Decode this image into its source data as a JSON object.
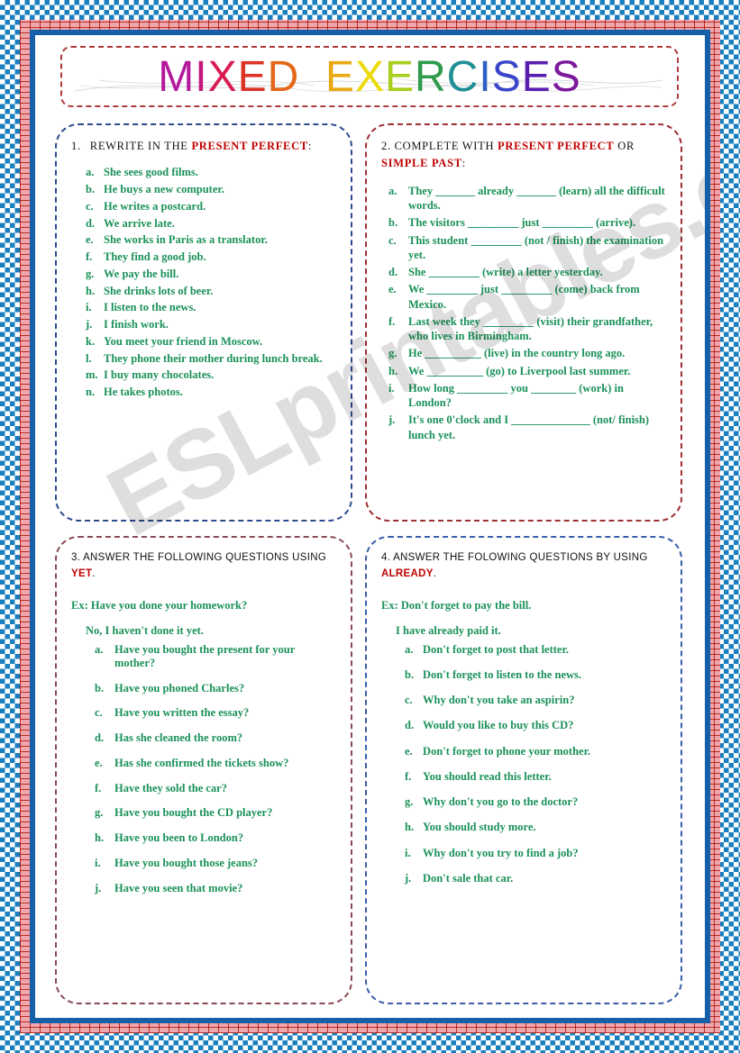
{
  "title": {
    "text": "MIXED EXERCISES",
    "letters": [
      {
        "ch": "M",
        "color": "#b5199b"
      },
      {
        "ch": "I",
        "color": "#c4177e"
      },
      {
        "ch": "X",
        "color": "#d81c52"
      },
      {
        "ch": "E",
        "color": "#dd3327"
      },
      {
        "ch": "D",
        "color": "#e4681a"
      },
      {
        "ch": " ",
        "color": "#ffffff"
      },
      {
        "ch": "E",
        "color": "#eaa812"
      },
      {
        "ch": "X",
        "color": "#ecd908"
      },
      {
        "ch": "E",
        "color": "#a8cf1d"
      },
      {
        "ch": "R",
        "color": "#2e9b4c"
      },
      {
        "ch": "C",
        "color": "#1f8f96"
      },
      {
        "ch": "I",
        "color": "#2b5fc4"
      },
      {
        "ch": "S",
        "color": "#3b45c9"
      },
      {
        "ch": "E",
        "color": "#5b1fb0"
      },
      {
        "ch": "S",
        "color": "#7b189b"
      }
    ]
  },
  "watermark": "ESLprintables.com",
  "colors": {
    "green": "#1a9159",
    "red_highlight": "#c00000",
    "panel1_border": "#2c4b8f",
    "panel2_border": "#9e2f33",
    "panel3_border": "#8a4a52",
    "panel4_border": "#3a5ea8",
    "frame_blue": "#1560a8",
    "frame_check": "#1a7fc1",
    "frame_brick": "#c0392b"
  },
  "exercises": [
    {
      "id": "exercise-1",
      "number": "1.",
      "heading_pre": "REWRITE IN THE ",
      "heading_hl": "PRESENT PERFECT",
      "heading_post": ":",
      "items": [
        {
          "label": "a.",
          "text": "She sees good films."
        },
        {
          "label": "b.",
          "text": "He buys a new computer."
        },
        {
          "label": "c.",
          "text": "He writes a postcard."
        },
        {
          "label": "d.",
          "text": "We arrive late."
        },
        {
          "label": "e.",
          "text": "She works in Paris as a translator."
        },
        {
          "label": "f.",
          "text": "They find a good job."
        },
        {
          "label": "g.",
          "text": "We pay the bill."
        },
        {
          "label": "h.",
          "text": "She drinks lots of beer."
        },
        {
          "label": "i.",
          "text": "I listen to the news."
        },
        {
          "label": "j.",
          "text": "I finish work."
        },
        {
          "label": "k.",
          "text": "You meet your friend in Moscow."
        },
        {
          "label": "l.",
          "text": "They phone their mother during lunch break."
        },
        {
          "label": "m.",
          "text": "I buy many chocolates."
        },
        {
          "label": "n.",
          "text": "He takes photos."
        }
      ]
    },
    {
      "id": "exercise-2",
      "number": "2.",
      "heading_pre": " COMPLETE WITH ",
      "heading_hl": "PRESENT PERFECT",
      "heading_mid": " OR ",
      "heading_hl2": "SIMPLE PAST",
      "heading_post": ":",
      "items": [
        {
          "label": "a.",
          "text": "They _______ already _______ (learn) all the difficult words."
        },
        {
          "label": "b.",
          "text": "The visitors _________ just _________ (arrive)."
        },
        {
          "label": "c.",
          "text": "This student _________ (not / finish) the examination yet."
        },
        {
          "label": "d.",
          "text": "She _________ (write) a letter yesterday."
        },
        {
          "label": "e.",
          "text": "We _________ just _________ (come) back from Mexico."
        },
        {
          "label": "f.",
          "text": "Last week they _________ (visit) their grandfather, who lives in Birmingham."
        },
        {
          "label": "g.",
          "text": "He __________ (live) in the country long ago."
        },
        {
          "label": "h.",
          "text": "We __________ (go) to Liverpool last summer."
        },
        {
          "label": "i.",
          "text": "How long _________ you ________ (work) in London?"
        },
        {
          "label": "j.",
          "text": "It's one 0'clock and I ______________ (not/ finish) lunch yet."
        }
      ]
    },
    {
      "id": "exercise-3",
      "number": "3.",
      "heading_pre": " ANSWER THE FOLLOWING QUESTIONS USING ",
      "heading_hl": "YET",
      "heading_post": ".",
      "example_q": "Ex: Have you done your homework?",
      "example_a": "No, I haven't done it yet.",
      "items": [
        {
          "label": "a.",
          "text": "Have you bought the present for your mother?"
        },
        {
          "label": "b.",
          "text": "Have you phoned Charles?"
        },
        {
          "label": "c.",
          "text": "Have you written the essay?"
        },
        {
          "label": "d.",
          "text": "Has she cleaned the room?"
        },
        {
          "label": "e.",
          "text": "Has she confirmed the tickets show?"
        },
        {
          "label": "f.",
          "text": "Have they sold the car?"
        },
        {
          "label": "g.",
          "text": "Have you bought the CD player?"
        },
        {
          "label": "h.",
          "text": "Have you been to London?"
        },
        {
          "label": "i.",
          "text": "Have you bought those jeans?"
        },
        {
          "label": "j.",
          "text": "Have you seen that movie?"
        }
      ]
    },
    {
      "id": "exercise-4",
      "number": "4.",
      "heading_pre": " ANSWER THE FOLOWING QUESTIONS BY USING ",
      "heading_hl": "ALREADY",
      "heading_post": ".",
      "example_q": "Ex: Don't forget to pay the bill.",
      "example_a": "I have already paid it.",
      "items": [
        {
          "label": "a.",
          "text": "Don't forget to post that letter."
        },
        {
          "label": "b.",
          "text": "Don't forget to listen to the news."
        },
        {
          "label": "c.",
          "text": "Why don't you take an aspirin?"
        },
        {
          "label": "d.",
          "text": "Would you like to buy this CD?"
        },
        {
          "label": "e.",
          "text": "Don't forget to phone your mother."
        },
        {
          "label": "f.",
          "text": "You should read this letter."
        },
        {
          "label": "g.",
          "text": "Why don't you go to the doctor?"
        },
        {
          "label": "h.",
          "text": "You should study more."
        },
        {
          "label": "i.",
          "text": "Why don't you try to find a job?"
        },
        {
          "label": "j.",
          "text": "Don't sale that car."
        }
      ]
    }
  ]
}
